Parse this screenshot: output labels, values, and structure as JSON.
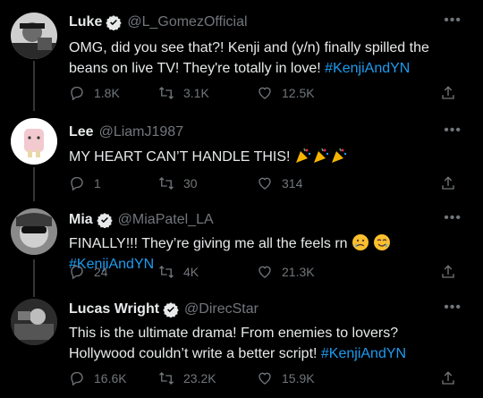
{
  "accent": "#1d9bf0",
  "tweets": [
    {
      "name": "Luke",
      "verified": true,
      "handle": "@L_GomezOfficial",
      "text_main": "OMG, did you see that?! Kenji and (y/n) finally spilled the beans on live TV! They're totally in love! ",
      "hashtag": "#KenjiAndYN",
      "replies": "1.8K",
      "retweets": "3.1K",
      "likes": "12.5K",
      "avatar_icon": "avatar-photo"
    },
    {
      "name": "Lee",
      "verified": false,
      "handle": "@LiamJ1987",
      "text_main": "MY HEART CAN’T HANDLE THIS! ",
      "emojis": [
        "party-popper",
        "party-popper",
        "party-popper"
      ],
      "replies": "1",
      "retweets": "30",
      "likes": "314",
      "avatar_icon": "avatar-cartoon"
    },
    {
      "name": "Mia",
      "verified": true,
      "handle": "@MiaPatel_LA",
      "text_main": "FINALLY!!! They’re giving me all the feels rn ",
      "emojis": [
        "crying-face",
        "smiling-face-with-tear"
      ],
      "hashtag": "#KenjiAndYN",
      "replies": "24",
      "retweets": "4K",
      "likes": "21.3K",
      "avatar_icon": "avatar-photo"
    },
    {
      "name": "Lucas Wright",
      "verified": true,
      "handle": "@DirecStar",
      "text_main": "This is the ultimate drama! From enemies to lovers? Hollywood couldn’t write a better script! ",
      "hashtag": "#KenjiAndYN",
      "replies": "16.6K",
      "retweets": "23.2K",
      "likes": "15.9K",
      "avatar_icon": "avatar-photo"
    }
  ],
  "more_label": "•••"
}
